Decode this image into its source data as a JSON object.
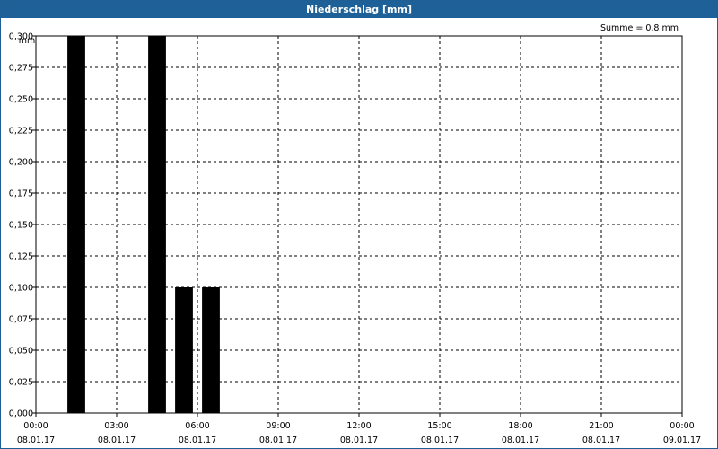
{
  "window": {
    "title": "Niederschlag [mm]"
  },
  "chart_data": {
    "type": "bar",
    "title": "Niederschlag [mm]",
    "ylabel": "mm",
    "annotation": "Summe = 0,8 mm",
    "ylim": [
      0,
      0.3
    ],
    "y_ticks": [
      "0,000",
      "0,025",
      "0,050",
      "0,075",
      "0,100",
      "0,125",
      "0,150",
      "0,175",
      "0,200",
      "0,225",
      "0,250",
      "0,275",
      "0,300"
    ],
    "x_ticks": [
      {
        "time": "00:00",
        "date": "08.01.17"
      },
      {
        "time": "03:00",
        "date": "08.01.17"
      },
      {
        "time": "06:00",
        "date": "08.01.17"
      },
      {
        "time": "09:00",
        "date": "08.01.17"
      },
      {
        "time": "12:00",
        "date": "08.01.17"
      },
      {
        "time": "15:00",
        "date": "08.01.17"
      },
      {
        "time": "18:00",
        "date": "08.01.17"
      },
      {
        "time": "21:00",
        "date": "08.01.17"
      },
      {
        "time": "00:00",
        "date": "09.01.17"
      }
    ],
    "x_range": [
      "08.01.17 00:00",
      "09.01.17 00:00"
    ],
    "grid": true,
    "bars": [
      {
        "start": "08.01.17 01:00",
        "end": "08.01.17 02:00",
        "value": 0.3
      },
      {
        "start": "08.01.17 04:00",
        "end": "08.01.17 05:00",
        "value": 0.3
      },
      {
        "start": "08.01.17 05:00",
        "end": "08.01.17 06:00",
        "value": 0.1
      },
      {
        "start": "08.01.17 06:00",
        "end": "08.01.17 07:00",
        "value": 0.1
      }
    ],
    "bar_color": "#000000"
  }
}
